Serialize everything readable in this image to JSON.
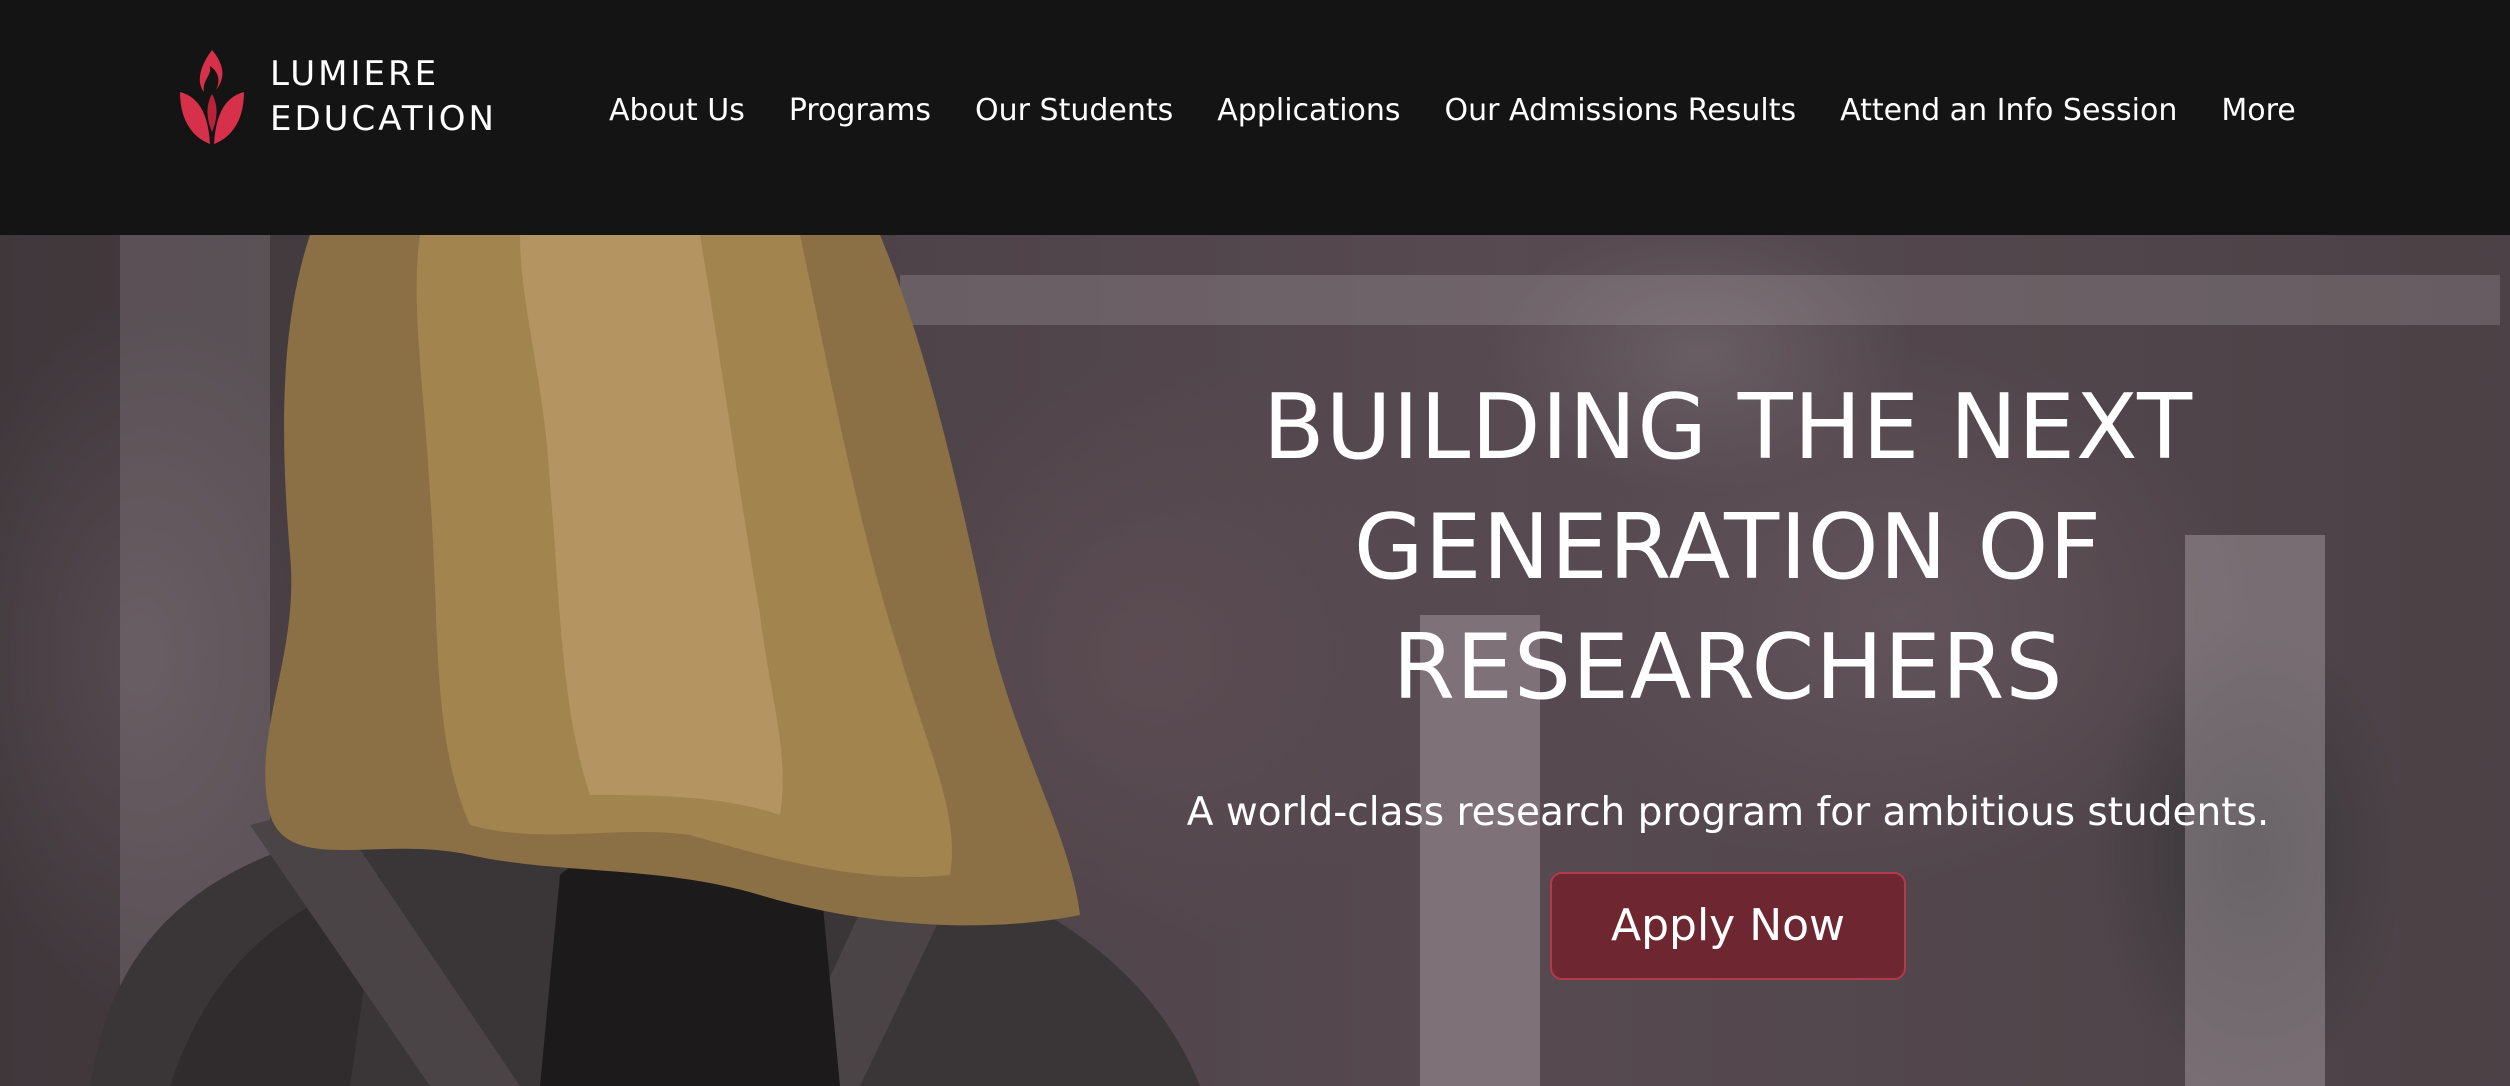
{
  "header": {
    "brand": {
      "line1": "LUMIERE",
      "line2": "EDUCATION",
      "logo_icon": "flame-leaf-logo-icon",
      "logo_color": "#d6304a"
    },
    "nav": [
      {
        "label": "About Us"
      },
      {
        "label": "Programs"
      },
      {
        "label": "Our Students"
      },
      {
        "label": "Applications"
      },
      {
        "label": "Our Admissions Results"
      },
      {
        "label": "Attend an Info Session"
      },
      {
        "label": "More"
      }
    ]
  },
  "hero": {
    "headline_lines": [
      "BUILDING THE NEXT",
      "GENERATION OF",
      "RESEARCHERS"
    ],
    "subhead": "A world-class research program for ambitious students.",
    "cta_label": "Apply Now",
    "cta_color": "#7a1a26"
  },
  "colors": {
    "header_bg": "#141414",
    "text": "#ffffff",
    "accent": "#d6304a"
  }
}
